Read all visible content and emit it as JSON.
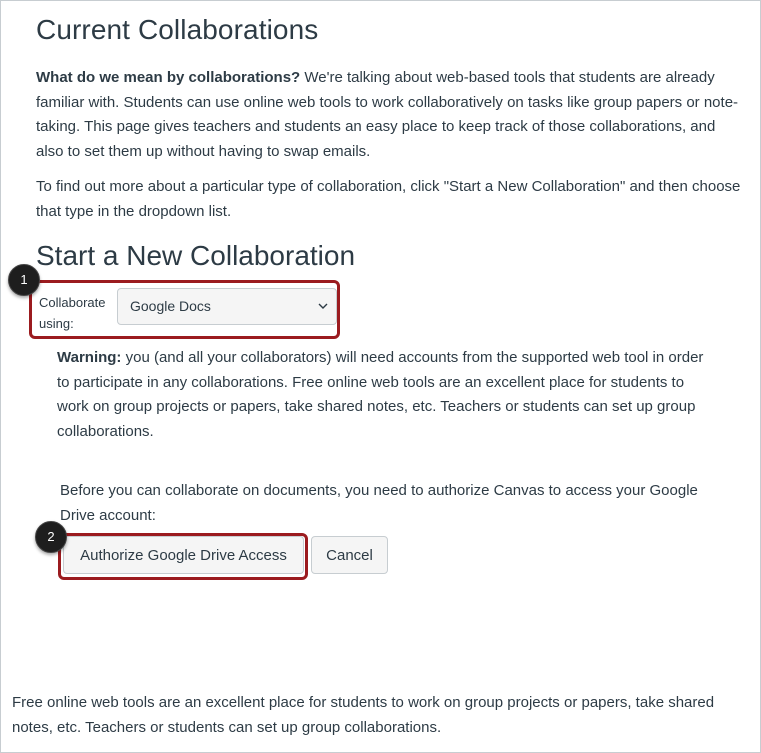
{
  "page_title": "Current Collaborations",
  "intro": {
    "bold": "What do we mean by collaborations?",
    "text": " We're talking about web-based tools that students are already familiar with. Students can use online web tools to work collaboratively on tasks like group papers or note-taking. This page gives teachers and students an easy place to keep track of those collaborations, and also to set them up without having to swap emails."
  },
  "find_out": "To find out more about a particular type of collaboration, click \"Start a New Collaboration\" and then choose that type in the dropdown list.",
  "section_title": "Start a New Collaboration",
  "collaborate": {
    "label": "Collaborate using:",
    "selected": "Google Docs"
  },
  "warning": {
    "bold": "Warning:",
    "text": " you (and all your collaborators) will need accounts from the supported web tool in order to participate in any collaborations. Free online web tools are an excellent place for students to work on group projects or papers, take shared notes, etc. Teachers or students can set up group collaborations."
  },
  "authorize_text": "Before you can collaborate on documents, you need to authorize Canvas to access your Google Drive account:",
  "buttons": {
    "authorize": "Authorize Google Drive Access",
    "cancel": "Cancel"
  },
  "callouts": {
    "one": "1",
    "two": "2"
  },
  "footer": "Free online web tools are an excellent place for students to work on group projects or papers, take shared notes, etc. Teachers or students can set up group collaborations.",
  "colors": {
    "callout": "#9b1b1f",
    "text": "#2d3b45",
    "button_bg": "#f5f5f5"
  }
}
